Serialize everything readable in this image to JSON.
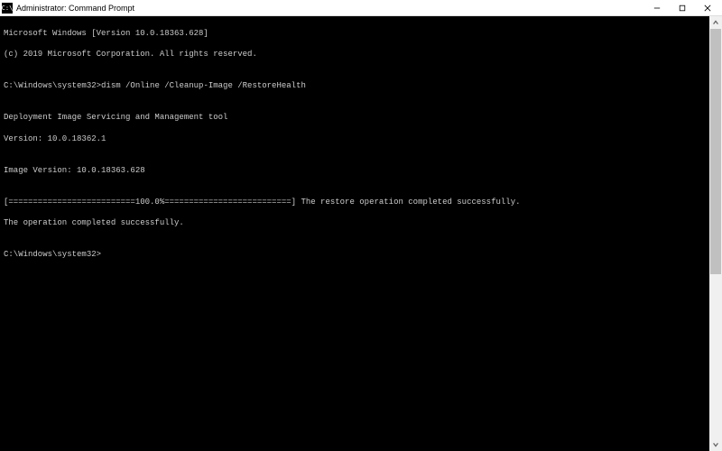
{
  "titlebar": {
    "title": "Administrator: Command Prompt",
    "icon_glyph": "C:\\"
  },
  "terminal": {
    "line1": "Microsoft Windows [Version 10.0.18363.628]",
    "line2": "(c) 2019 Microsoft Corporation. All rights reserved.",
    "blank1": "",
    "prompt1_path": "C:\\Windows\\system32>",
    "prompt1_cmd": "dism /Online /Cleanup-Image /RestoreHealth",
    "blank2": "",
    "tool_line1": "Deployment Image Servicing and Management tool",
    "tool_line2": "Version: 10.0.18362.1",
    "blank3": "",
    "image_version": "Image Version: 10.0.18363.628",
    "blank4": "",
    "progress_line": "[==========================100.0%==========================] The restore operation completed successfully.",
    "completed": "The operation completed successfully.",
    "blank5": "",
    "prompt2_path": "C:\\Windows\\system32>"
  }
}
